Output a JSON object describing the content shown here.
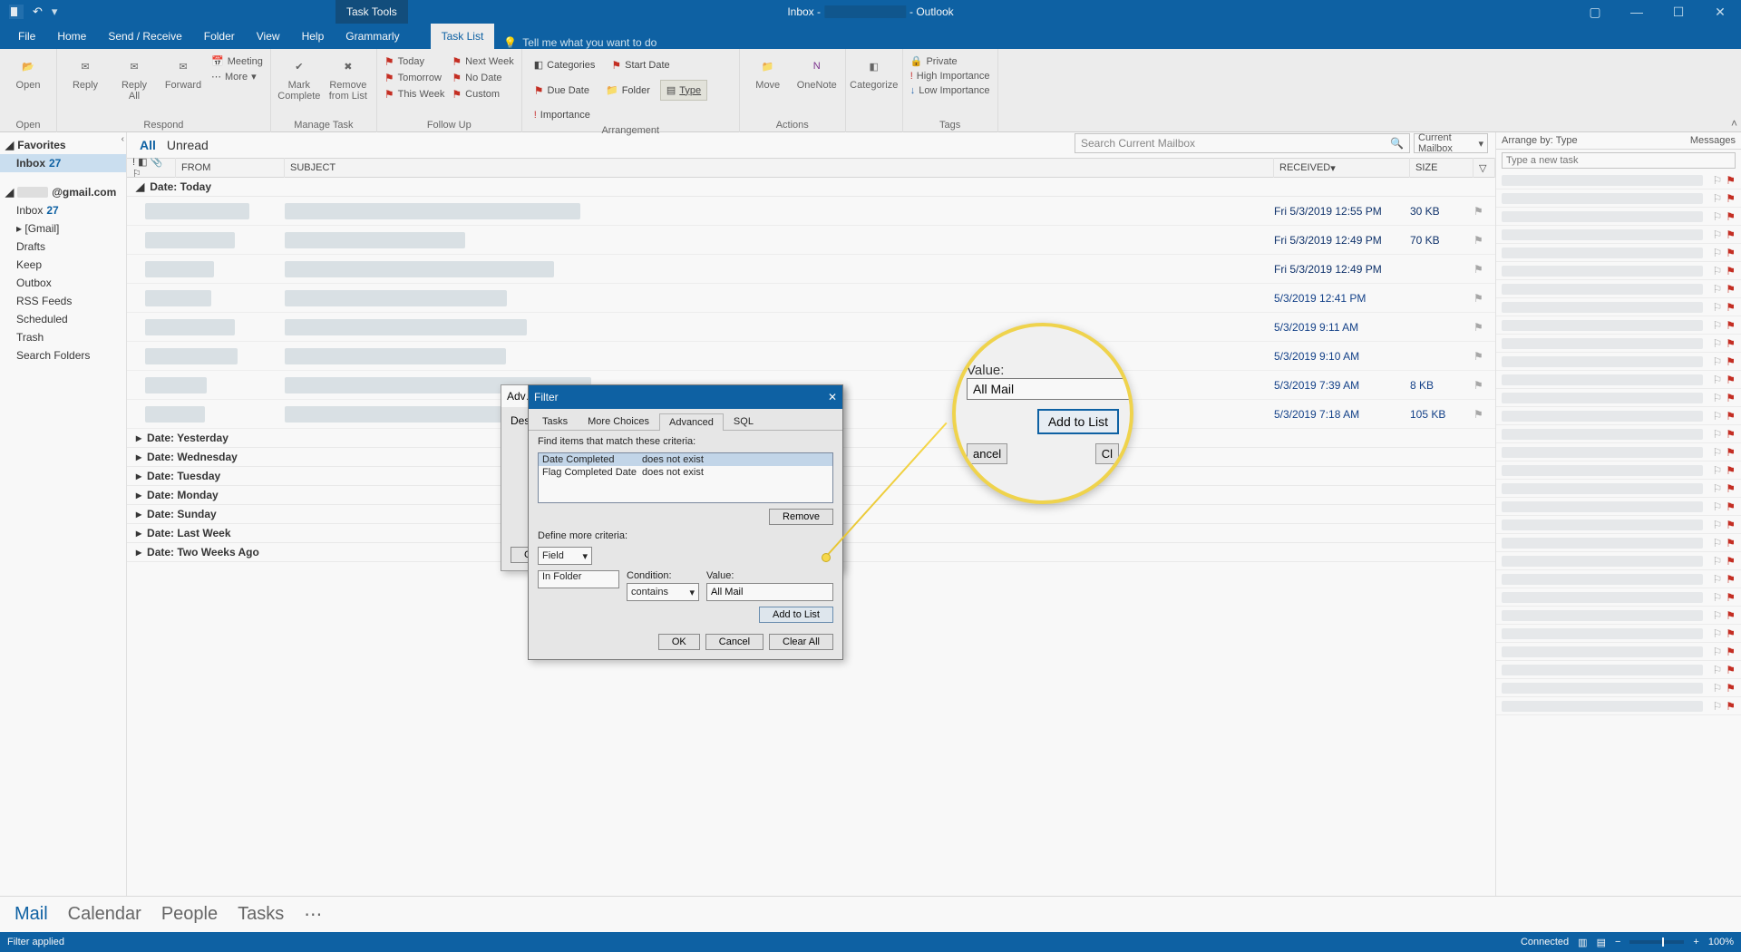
{
  "titlebar": {
    "context_tool": "Task Tools",
    "title_prefix": "Inbox -",
    "title_suffix": "- Outlook"
  },
  "ribbon_tabs": {
    "file": "File",
    "home": "Home",
    "sendreceive": "Send / Receive",
    "folder": "Folder",
    "view": "View",
    "help": "Help",
    "grammarly": "Grammarly",
    "tasklist": "Task List",
    "tellme": "Tell me what you want to do"
  },
  "ribbon": {
    "open": {
      "open": "Open",
      "grp": "Open"
    },
    "respond": {
      "reply": "Reply",
      "replyall": "Reply\nAll",
      "forward": "Forward",
      "meeting": "Meeting",
      "more": "More",
      "grp": "Respond"
    },
    "manage": {
      "mark": "Mark\nComplete",
      "remove": "Remove\nfrom List",
      "grp": "Manage Task"
    },
    "followup": {
      "today": "Today",
      "tomorrow": "Tomorrow",
      "thisweek": "This Week",
      "nextweek": "Next Week",
      "nodate": "No Date",
      "custom": "Custom",
      "grp": "Follow Up"
    },
    "arrange": {
      "categories": "Categories",
      "startdate": "Start Date",
      "duedate": "Due Date",
      "folder": "Folder",
      "type": "Type",
      "importance": "Importance",
      "grp": "Arrangement"
    },
    "actions": {
      "move": "Move",
      "onenote": "OneNote",
      "grp": "Actions"
    },
    "cat": {
      "categorize": "Categorize"
    },
    "tags": {
      "private": "Private",
      "high": "High Importance",
      "low": "Low Importance",
      "grp": "Tags"
    }
  },
  "nav": {
    "favorites": "Favorites",
    "inbox": "Inbox",
    "inbox_count": "27",
    "account": "@gmail.com",
    "items": {
      "inbox": "Inbox",
      "gmail": "[Gmail]",
      "drafts": "Drafts",
      "keep": "Keep",
      "outbox": "Outbox",
      "rss": "RSS Feeds",
      "scheduled": "Scheduled",
      "trash": "Trash",
      "search": "Search Folders"
    }
  },
  "list": {
    "all": "All",
    "unread": "Unread",
    "search_ph": "Search Current Mailbox",
    "scope": "Current Mailbox",
    "cols": {
      "from": "FROM",
      "subject": "SUBJECT",
      "received": "RECEIVED",
      "size": "SIZE"
    },
    "groups": {
      "today": "Date: Today",
      "yesterday": "Date: Yesterday",
      "wednesday": "Date: Wednesday",
      "tuesday": "Date: Tuesday",
      "monday": "Date: Monday",
      "sunday": "Date: Sunday",
      "lastweek": "Date: Last Week",
      "twoweeks": "Date: Two Weeks Ago"
    },
    "msgs": [
      {
        "recv": "Fri 5/3/2019 12:55 PM",
        "size": "30 KB",
        "flag": false
      },
      {
        "recv": "Fri 5/3/2019 12:49 PM",
        "size": "70 KB",
        "flag": false
      },
      {
        "recv": "Fri 5/3/2019 12:49 PM",
        "size": "",
        "flag": false
      },
      {
        "recv": "5/3/2019 12:41 PM",
        "size": "",
        "flag": false
      },
      {
        "recv": "5/3/2019 9:11 AM",
        "size": "",
        "flag": false
      },
      {
        "recv": "5/3/2019 9:10 AM",
        "size": "",
        "flag": false
      },
      {
        "recv": "5/3/2019 7:39 AM",
        "size": "8 KB",
        "flag": false
      },
      {
        "recv": "5/3/2019 7:18 AM",
        "size": "105 KB",
        "flag": true
      }
    ]
  },
  "taskpane": {
    "arrange": "Arrange by: Type",
    "messages": "Messages",
    "new_task_ph": "Type a new task"
  },
  "advf": {
    "title": "Adv…",
    "desc": "Des",
    "co": "Co"
  },
  "filter": {
    "title": "Filter",
    "tabs": {
      "tasks": "Tasks",
      "more": "More Choices",
      "adv": "Advanced",
      "sql": "SQL"
    },
    "find_label": "Find items that match these criteria:",
    "criteria": [
      {
        "field": "Date Completed",
        "cond": "does not exist"
      },
      {
        "field": "Flag Completed Date",
        "cond": "does not exist"
      }
    ],
    "remove": "Remove",
    "define": "Define more criteria:",
    "field_btn": "Field",
    "cond_label": "Condition:",
    "cond_val": "contains",
    "value_label": "Value:",
    "in_folder": "In Folder",
    "value_val": "All Mail",
    "add": "Add to List",
    "ok": "OK",
    "cancel": "Cancel",
    "clear": "Clear All"
  },
  "magnifier": {
    "value_label": "Value:",
    "value_val": "All Mail",
    "add": "Add to List",
    "cancel": "ancel",
    "close": "Cl"
  },
  "switch": {
    "mail": "Mail",
    "cal": "Calendar",
    "people": "People",
    "tasks": "Tasks"
  },
  "status": {
    "left": "Filter applied",
    "connected": "Connected",
    "zoom": "100%"
  }
}
